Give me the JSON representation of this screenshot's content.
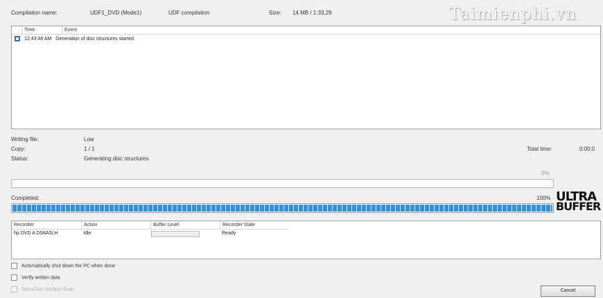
{
  "top": {
    "compilation_name_label": "Compilation name:",
    "compilation_name_value": "UDF1_DVD (Mode1)",
    "compilation_type": "UDF compilation",
    "size_label": "Size:",
    "size_value": "14 MB  /  1:33.29"
  },
  "watermark": "Taimienphi.vn",
  "event_log": {
    "columns": [
      "Time",
      "Event"
    ],
    "rows": [
      {
        "time": "12:43:46 AM",
        "event": "Generation of disc structures started",
        "icon": "info-icon"
      }
    ]
  },
  "info": {
    "writing_file_label": "Writing file:",
    "writing_file_value": "Low",
    "copy_label": "Copy:",
    "copy_value": "1 / 1",
    "status_label": "Status:",
    "status_value": "Generating disc structures",
    "total_time_label": "Total time:",
    "total_time_value": "0:00:0"
  },
  "progress": {
    "current_percent_label": "0%",
    "current_value": 0,
    "completed_label": "Completed:",
    "completed_percent_label": "100%",
    "completed_value": 1.0
  },
  "logo": {
    "line1": "ULTRA",
    "line2": "BUFFER"
  },
  "recorders": {
    "columns": [
      "Recorder",
      "Action",
      "Buffer Level",
      "Recorder State"
    ],
    "rows": [
      {
        "recorder": "hp DVD A  DS8A5LH",
        "action": "Idle",
        "buffer_level": 0,
        "state": "Ready"
      }
    ]
  },
  "options": {
    "auto_shutdown": "Automatically shut down the PC when done",
    "verify": "Verify written data",
    "securdisc": "SecurDisc Surface Scan"
  },
  "buttons": {
    "cancel": "Cancel"
  },
  "colors": {
    "progress_fill": "#2e8fe6"
  }
}
